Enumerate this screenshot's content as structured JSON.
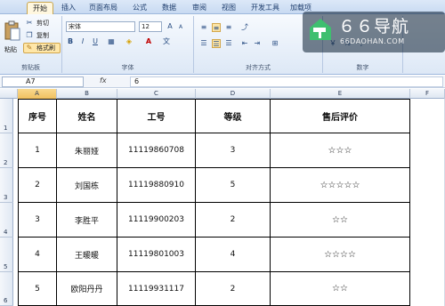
{
  "ribbon_tabs": [
    "开始",
    "插入",
    "页面布局",
    "公式",
    "数据",
    "审阅",
    "视图",
    "开发工具",
    "加载项"
  ],
  "clipboard": {
    "paste": "粘贴",
    "cut": "剪切",
    "copy": "复制",
    "format_painter": "格式刷",
    "group_label": "剪贴板"
  },
  "font": {
    "name": "宋体",
    "size": "12",
    "bold": "B",
    "italic": "I",
    "underline": "U",
    "group_label": "字体"
  },
  "alignment": {
    "group_label": "对齐方式"
  },
  "number": {
    "group_label": "数字"
  },
  "watermark": {
    "title": "６６导航",
    "url": "66DAOHAN.COM"
  },
  "formula_bar": {
    "name_box": "A7",
    "fx": "fx",
    "value": "6"
  },
  "columns": [
    "A",
    "B",
    "C",
    "D",
    "E",
    "F"
  ],
  "rows": [
    "1",
    "2",
    "3",
    "4",
    "5",
    "6"
  ],
  "table": {
    "headers": [
      "序号",
      "姓名",
      "工号",
      "等级",
      "售后评价"
    ],
    "rows": [
      [
        "1",
        "朱丽娅",
        "11119860708",
        "3",
        "☆☆☆"
      ],
      [
        "2",
        "刘国栋",
        "11119880910",
        "5",
        "☆☆☆☆☆"
      ],
      [
        "3",
        "李胜平",
        "11119900203",
        "2",
        "☆☆"
      ],
      [
        "4",
        "王暖暖",
        "11119801003",
        "4",
        "☆☆☆☆"
      ],
      [
        "5",
        "欧阳丹丹",
        "11119931117",
        "2",
        "☆☆"
      ]
    ]
  },
  "colors": {
    "accent": "#f0c060",
    "ribbon": "#dde8f6",
    "watermark_bg": "#1e3246"
  }
}
